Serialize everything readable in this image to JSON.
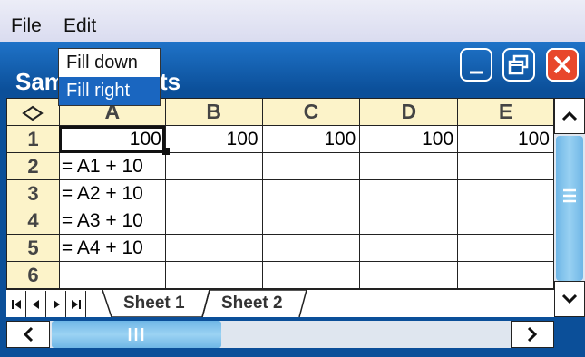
{
  "menubar": {
    "file_label": "File",
    "edit_label": "Edit"
  },
  "window": {
    "title": "Sample sheets"
  },
  "edit_menu": {
    "items": [
      "Fill down",
      "Fill right"
    ],
    "highlighted": "Fill right"
  },
  "spreadsheet": {
    "corner_icon": "diamond-outline-icon",
    "columns": [
      "A",
      "B",
      "C",
      "D",
      "E"
    ],
    "rows": [
      {
        "header": "1",
        "cells": [
          "100",
          "100",
          "100",
          "100",
          "100"
        ]
      },
      {
        "header": "2",
        "cells": [
          "= A1 + 10",
          "",
          "",
          "",
          ""
        ]
      },
      {
        "header": "3",
        "cells": [
          "= A2 + 10",
          "",
          "",
          "",
          ""
        ]
      },
      {
        "header": "4",
        "cells": [
          "= A3 + 10",
          "",
          "",
          "",
          ""
        ]
      },
      {
        "header": "5",
        "cells": [
          "= A4 + 10",
          "",
          "",
          "",
          ""
        ]
      },
      {
        "header": "6",
        "cells": [
          "",
          "",
          "",
          "",
          ""
        ]
      }
    ],
    "selected_cell": "A1"
  },
  "sheet_tabs": [
    "Sheet 1",
    "Sheet 2"
  ],
  "active_sheet": "Sheet 1",
  "colors": {
    "title_bar": "#1366b8",
    "header_cells": "#fcf3c9",
    "menu_highlight": "#1a66c0",
    "close_button": "#e8472b",
    "scroll_thumb": "#7cc0ea"
  }
}
